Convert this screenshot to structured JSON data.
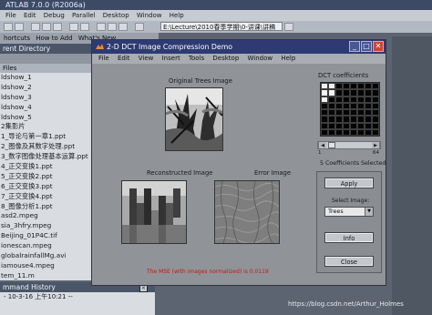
{
  "ide": {
    "title": "ATLAB  7.0.0 (R2006a)",
    "menu": [
      "File",
      "Edit",
      "Debug",
      "Parallel",
      "Desktop",
      "Window",
      "Help"
    ],
    "current_path": "E:\\Lecture\\2010春季学期\\0-讲课\\讲稿",
    "shortcuts": [
      "hortcuts",
      "How to Add",
      "What's New"
    ],
    "current_directory_label": "rent Directory",
    "files_header": "Files",
    "files": [
      "ldshow_1",
      "ldshow_2",
      "ldshow_3",
      "ldshow_4",
      "ldshow_5",
      "2集影片",
      "1_导论与第一章1.ppt",
      "2_图像及其数字处理.ppt",
      "3_数字图像处理基本运算.ppt",
      "4_正交变换1.ppt",
      "5_正交变换2.ppt",
      "6_正交变换3.ppt",
      "7_正交变换4.ppt",
      "8_图像分析1.ppt",
      "asd2.mpeg",
      "sia_3hfry.mpeg",
      "Beijing_01P4C.tif",
      "ionescan.mpeg",
      "globalrainfallMg.avi",
      "iamouse4.mpeg",
      "tem_11.m",
      "tem_11.m"
    ],
    "history_label": "mmand History",
    "history_line": "- 10-3-16  上午10:21 --"
  },
  "window": {
    "title": "2-D DCT Image Compression Demo",
    "menu": [
      "File",
      "Edit",
      "View",
      "Insert",
      "Tools",
      "Desktop",
      "Window",
      "Help"
    ],
    "original_label": "Original Trees Image",
    "reconstructed_label": "Reconstructed Image",
    "error_label": "Error Image",
    "mse_text": "The MSE (with images normalized) is 0.0119",
    "coeff_title": "DCT coefficients",
    "slider_min": "1",
    "slider_max": "64",
    "coeff_selected_text": "5 Coefficients Selected",
    "coefficients_selected": 5,
    "apply_label": "Apply",
    "select_image_label": "Select Image:",
    "select_image_value": "Trees",
    "info_label": "Info",
    "close_label": "Close"
  },
  "watermark": "https://blog.csdn.net/Arthur_Holmes"
}
